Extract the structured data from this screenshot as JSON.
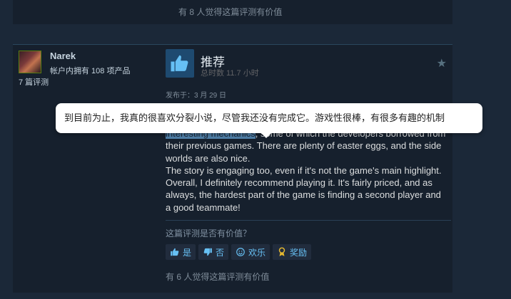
{
  "previous_review": {
    "helpful_count_text": "有 8 人觉得这篇评测有价值"
  },
  "review": {
    "author": {
      "name": "Narek",
      "products_owned": "帐户内拥有 108 项产品",
      "review_count": "7 篇评测"
    },
    "verdict": "推荐",
    "hours": "总时数 11.7 小时",
    "posted_date": "发布于：3 月 29 日",
    "highlighted_text": "interesting mechanics",
    "body_line1_rest": ", some of which the developers borrowed",
    "body_line2": "from their previous games. There are plenty of easter eggs, and the side worlds are also nice.",
    "body_paragraph2": "The story is engaging too, even if it's not the game's main highlight. Overall, I definitely recommend playing it. It's fairly priced, and as always, the hardest part of the game is finding a second player and a good teammate!",
    "helpful_question": "这篇评测是否有价值？",
    "votes": {
      "yes": "是",
      "no": "否",
      "funny": "欢乐",
      "award": "奖励"
    },
    "helpful_count_text": "有 6 人觉得这篇评测有价值"
  },
  "translation_tooltip": {
    "text": "到目前为止，我真的很喜欢分裂小说，尽管我还没有完成它。游戏性很棒，有很多有趣的机制"
  },
  "colors": {
    "background": "#1b2838",
    "card": "#16202d",
    "accent": "#67c1f5",
    "thumb_box": "#1e4a70"
  },
  "icons": {
    "thumbs_up": "thumbs-up-icon",
    "thumbs_down": "thumbs-down-icon",
    "funny": "smiley-icon",
    "award": "award-icon",
    "star": "star-icon"
  }
}
